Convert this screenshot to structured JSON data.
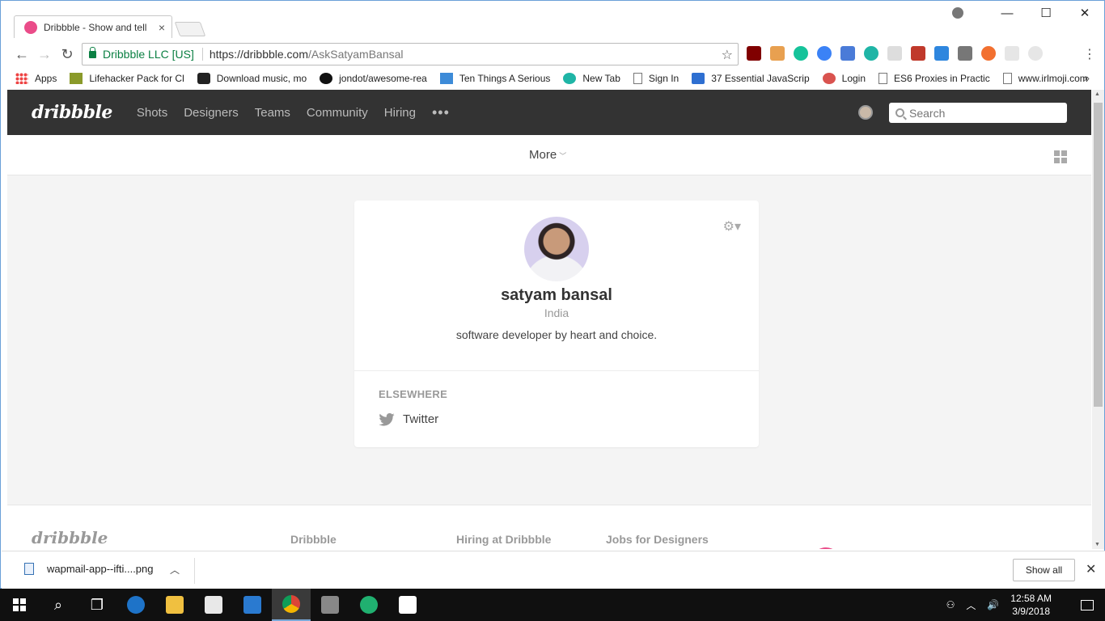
{
  "browser": {
    "tab_title": "Dribbble - Show and tell",
    "tab_close": "×",
    "url_secure_label": "Dribbble LLC [US]",
    "url_host": "https://dribbble.com",
    "url_path": "/AskSatyamBansal",
    "bookmarks": [
      {
        "label": "Apps",
        "icon": "apps-icon"
      },
      {
        "label": "Lifehacker Pack for Cl",
        "icon": "lifehacker-icon"
      },
      {
        "label": "Download music, mo",
        "icon": "car-icon"
      },
      {
        "label": "jondot/awesome-rea",
        "icon": "github-icon"
      },
      {
        "label": "Ten Things A Serious",
        "icon": "code-icon"
      },
      {
        "label": "New Tab",
        "icon": "m-icon"
      },
      {
        "label": "Sign In",
        "icon": "page-icon"
      },
      {
        "label": "37 Essential JavaScrip",
        "icon": "bookmark-icon"
      },
      {
        "label": "Login",
        "icon": "swirl-icon"
      },
      {
        "label": "ES6 Proxies in Practic",
        "icon": "page-icon"
      },
      {
        "label": "www.irlmoji.com",
        "icon": "page-icon"
      }
    ],
    "bookmarks_overflow": "»"
  },
  "site": {
    "logo": "dribbble",
    "nav": [
      "Shots",
      "Designers",
      "Teams",
      "Community",
      "Hiring"
    ],
    "nav_more": "•••",
    "search_placeholder": "Search",
    "subnav_more": "More"
  },
  "profile": {
    "name": "satyam bansal",
    "location": "India",
    "bio": "software developer by heart and choice.",
    "elsewhere_title": "ELSEWHERE",
    "links": [
      {
        "label": "Twitter",
        "icon": "twitter-icon"
      }
    ]
  },
  "footer": {
    "logo": "dribbble",
    "columns": [
      "Dribbble",
      "Hiring at Dribbble",
      "Jobs for Designers"
    ]
  },
  "downloads": {
    "file_name": "wapmail-app--ifti....png",
    "show_all": "Show all"
  },
  "taskbar": {
    "time": "12:58 AM",
    "date": "3/9/2018"
  },
  "colors": {
    "brand_pink": "#ea4c89",
    "header_dark": "#333333",
    "secure_green": "#0b8043"
  }
}
